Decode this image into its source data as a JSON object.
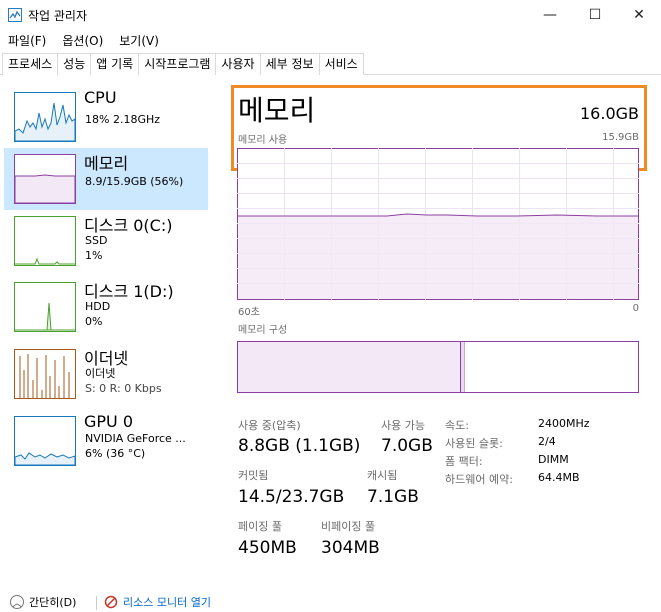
{
  "window": {
    "title": "작업 관리자",
    "controls": {
      "minimize": "—",
      "maximize": "☐",
      "close": "✕"
    }
  },
  "menu": [
    "파일(F)",
    "옵션(O)",
    "보기(V)"
  ],
  "tabs": [
    {
      "label": "프로세스",
      "active": false
    },
    {
      "label": "성능",
      "active": true
    },
    {
      "label": "앱 기록",
      "active": false
    },
    {
      "label": "시작프로그램",
      "active": false
    },
    {
      "label": "사용자",
      "active": false
    },
    {
      "label": "세부 정보",
      "active": false
    },
    {
      "label": "서비스",
      "active": false
    }
  ],
  "sidebar": {
    "items": [
      {
        "title": "CPU",
        "sub1": "18% 2.18GHz",
        "sub2": "",
        "color": "#1779ba",
        "selected": false
      },
      {
        "title": "메모리",
        "sub1": "8.9/15.9GB (56%)",
        "sub2": "",
        "color": "#8b3fa3",
        "selected": true
      },
      {
        "title": "디스크 0(C:)",
        "sub1": "SSD",
        "sub2": "1%",
        "color": "#4aa02c",
        "selected": false
      },
      {
        "title": "디스크 1(D:)",
        "sub1": "HDD",
        "sub2": "0%",
        "color": "#4aa02c",
        "selected": false
      },
      {
        "title": "이더넷",
        "sub1": "이더넷",
        "sub2": "S: 0 R: 0 Kbps",
        "color": "#a7581b",
        "selected": false
      },
      {
        "title": "GPU 0",
        "sub1": "NVIDIA GeForce ...",
        "sub2": "6% (36 °C)",
        "color": "#1779ba",
        "selected": false
      }
    ]
  },
  "main": {
    "title": "메모리",
    "total": "16.0GB",
    "usage_label": "메모리 사용",
    "usage_max": "15.9GB",
    "axis_left": "60초",
    "axis_right": "0",
    "composition_label": "메모리 구성",
    "usage_fraction": 0.56,
    "accent": "#8b3fa3",
    "highlight": "#f08a24",
    "stats": {
      "in_use_label": "사용 중(압축)",
      "in_use_value": "8.8GB (1.1GB)",
      "available_label": "사용 가능",
      "available_value": "7.0GB",
      "committed_label": "커밋됨",
      "committed_value": "14.5/23.7GB",
      "cached_label": "캐시됨",
      "cached_value": "7.1GB",
      "paged_label": "페이징 풀",
      "paged_value": "450MB",
      "nonpaged_label": "비페이징 풀",
      "nonpaged_value": "304MB"
    },
    "details": [
      {
        "key": "속도:",
        "value": "2400MHz"
      },
      {
        "key": "사용된 슬롯:",
        "value": "2/4"
      },
      {
        "key": "폼 팩터:",
        "value": "DIMM"
      },
      {
        "key": "하드웨어 예약:",
        "value": "64.4MB"
      }
    ]
  },
  "footer": {
    "collapse": "간단히(D)",
    "resource_monitor": "리소스 모니터 열기"
  }
}
